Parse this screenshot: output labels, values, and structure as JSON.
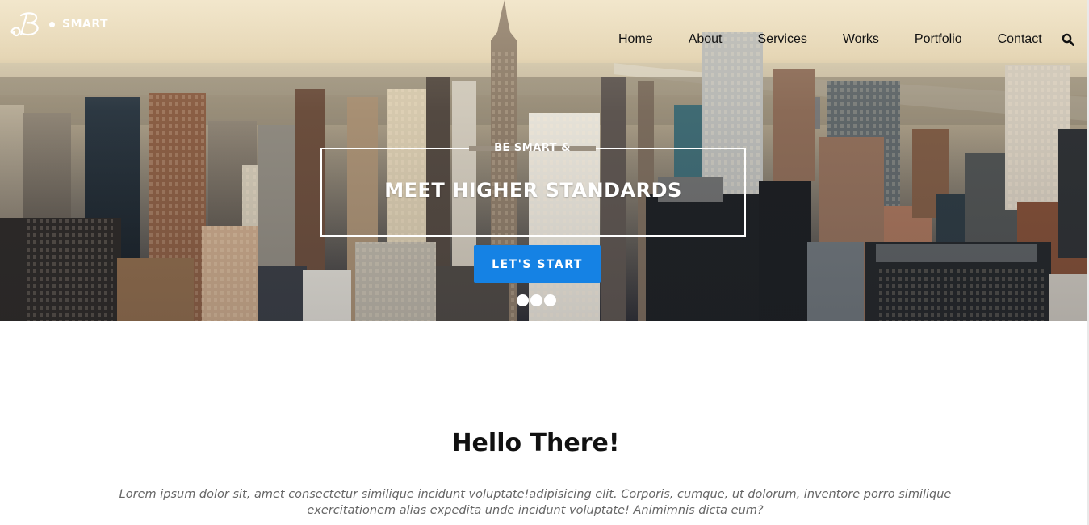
{
  "brand": {
    "logo_icon": "script-b-logo-icon",
    "name": "SMART"
  },
  "nav": {
    "items": [
      {
        "label": "Home"
      },
      {
        "label": "About"
      },
      {
        "label": "Services"
      },
      {
        "label": "Works"
      },
      {
        "label": "Portfolio"
      },
      {
        "label": "Contact"
      }
    ],
    "search_icon": "search-icon"
  },
  "hero": {
    "eyebrow": "BE SMART &",
    "headline": "MEET HIGHER STANDARDS",
    "cta_label": "LET'S START",
    "slider_dots": 3,
    "cta_color": "#1582e4"
  },
  "intro": {
    "title": "Hello There!",
    "body_line1": "Lorem ipsum dolor sit, amet consectetur similique incidunt voluptate!adipisicing elit. Corporis, cumque, ut dolorum, inventore porro similique",
    "body_line2": "exercitationem alias expedita unde incidunt voluptate! Animimnis dicta eum?"
  }
}
